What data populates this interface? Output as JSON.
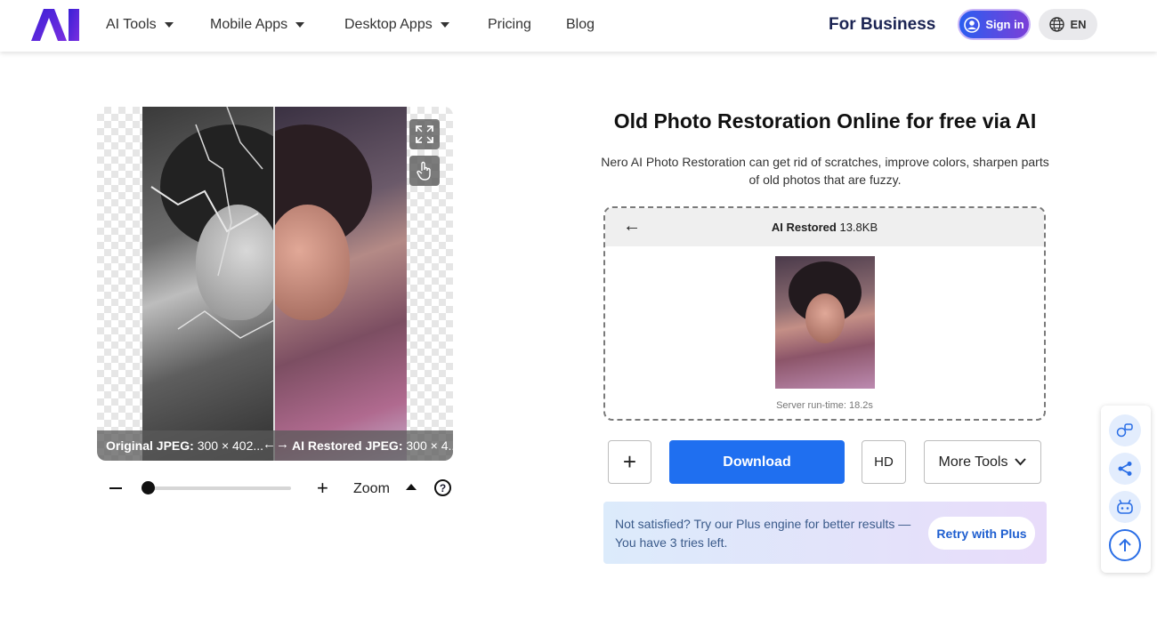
{
  "header": {
    "logo_text": "AI",
    "nav": [
      {
        "label": "AI Tools",
        "has_dropdown": true
      },
      {
        "label": "Mobile Apps",
        "has_dropdown": true
      },
      {
        "label": "Desktop Apps",
        "has_dropdown": true
      },
      {
        "label": "Pricing",
        "has_dropdown": false
      },
      {
        "label": "Blog",
        "has_dropdown": false
      }
    ],
    "for_business": "For Business",
    "sign_in": "Sign in",
    "language": "EN"
  },
  "viewer": {
    "original_label": "Original JPEG:",
    "original_dims": "300 × 402...",
    "restored_label": "AI Restored JPEG:",
    "restored_dims": "300 × 4...",
    "compare_arrow": "←→",
    "zoom_label": "Zoom",
    "zoom_value": 0.0
  },
  "main": {
    "title": "Old Photo Restoration Online for free via AI",
    "subtitle": "Nero AI Photo Restoration can get rid of scratches, improve colors, sharpen parts of old photos that are fuzzy.",
    "result": {
      "label": "AI Restored",
      "size": "13.8KB",
      "runtime": "Server run-time: 18.2s"
    },
    "buttons": {
      "add": "+",
      "download": "Download",
      "hd": "HD",
      "more_tools": "More Tools"
    },
    "notice": {
      "text": "Not satisfied? Try our Plus engine for better results — You have 3 tries left.",
      "retry": "Retry with Plus"
    }
  },
  "colors": {
    "primary": "#1f6ff0",
    "brand_dark": "#1b2453",
    "notice_text": "#3a5a8a"
  }
}
